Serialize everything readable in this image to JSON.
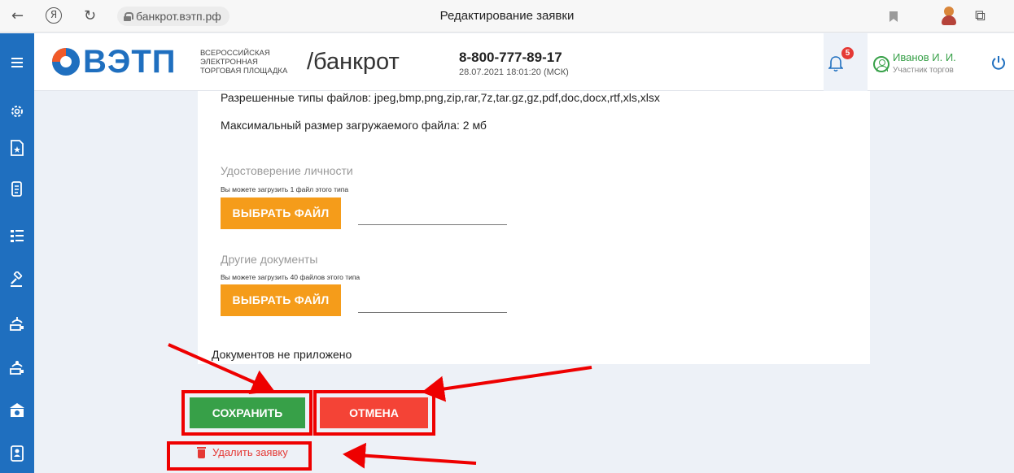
{
  "browser": {
    "back_icon": "←",
    "yandex_icon": "Я",
    "reload_icon": "↻",
    "url": "банкрот.вэтп.рф",
    "page_title": "Редактирование заявки",
    "puzzle_icon": "⧉"
  },
  "header": {
    "logo_word": "ВЭТП",
    "logo_sub_1": "всероссийская",
    "logo_sub_2": "электронная",
    "logo_sub_3": "торговая площадка",
    "section": "/банкрот",
    "phone": "8-800-777-89-17",
    "datetime": "28.07.2021 18:01:20 (МСК)",
    "notifications_count": "5",
    "user_name": "Иванов И. И.",
    "user_role": "Участник торгов"
  },
  "sidebar": {
    "items": [
      "settings-icon",
      "document-star-icon",
      "scroll-icon",
      "list-icon",
      "gavel-icon",
      "auction-icon",
      "auction-alt-icon",
      "bank-icon",
      "contacts-icon"
    ]
  },
  "form": {
    "allowed_types": "Разрешенные типы файлов: jpeg,bmp,png,zip,rar,7z,tar.gz,gz,pdf,doc,docx,rtf,xls,xlsx",
    "max_size": "Максимальный размер загружаемого файла: 2 мб",
    "sections": [
      {
        "title": "Удостоверение личности",
        "note": "Вы можете загрузить 1 файл этого типа",
        "button": "ВЫБРАТЬ ФАЙЛ"
      },
      {
        "title": "Другие документы",
        "note": "Вы можете загрузить 40 файлов этого типа",
        "button": "ВЫБРАТЬ ФАЙЛ"
      }
    ],
    "no_documents": "Документов не приложено"
  },
  "actions": {
    "save": "СОХРАНИТЬ",
    "cancel": "ОТМЕНА",
    "delete": "Удалить заявку"
  },
  "colors": {
    "brand_blue": "#1f6fbf",
    "orange": "#f59c1a",
    "green": "#37a048",
    "red": "#f44336",
    "annotation_red": "#ee0000"
  }
}
